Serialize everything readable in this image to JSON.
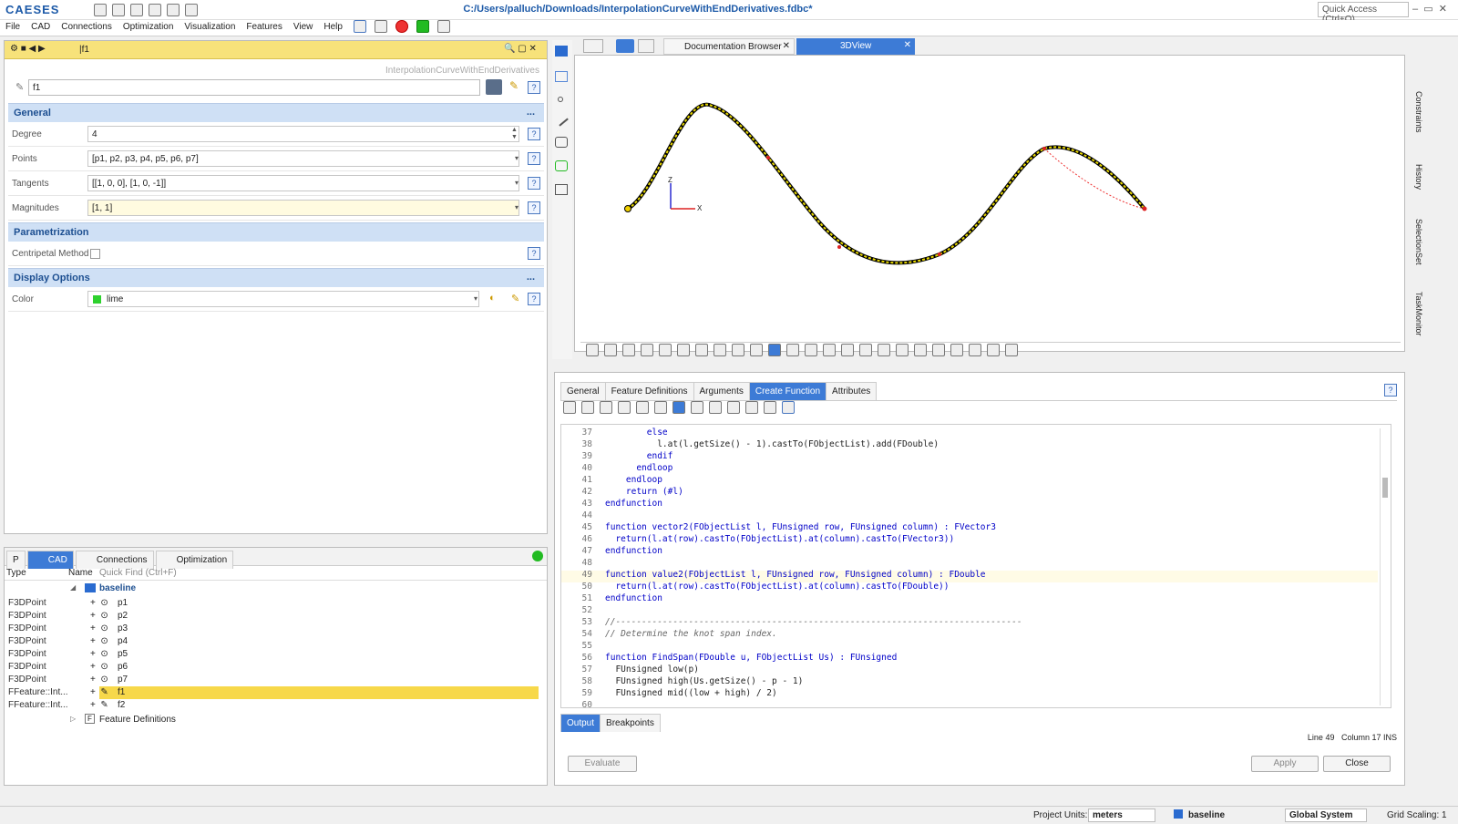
{
  "app": {
    "logo": "CAESES",
    "title": "C:/Users/palluch/Downloads/InterpolationCurveWithEndDerivatives.fdbc*",
    "quick_access": "Quick Access (Ctrl+Q)"
  },
  "menu": [
    "File",
    "CAD",
    "Connections",
    "Optimization",
    "Visualization",
    "Features",
    "View",
    "Help"
  ],
  "props": {
    "header_name": "|f1",
    "context": "InterpolationCurveWithEndDerivatives",
    "name_value": "f1",
    "general": "General",
    "parametrization": "Parametrization",
    "display": "Display Options",
    "more": "...",
    "rows": [
      {
        "label": "Degree",
        "value": "4"
      },
      {
        "label": "Points",
        "value": "[p1, p2, p3, p4, p5, p6, p7]"
      },
      {
        "label": "Tangents",
        "value": "[[1, 0, 0], [1, 0, -1]]"
      },
      {
        "label": "Magnitudes",
        "value": "[1, 1]"
      }
    ],
    "centripetal": "Centripetal Method",
    "color_label": "Color",
    "color_value": "lime"
  },
  "tree": {
    "tabs": [
      "P",
      "CAD",
      "Connections",
      "Optimization"
    ],
    "col_type": "Type",
    "col_name": "Name",
    "quick_find": "Quick Find (Ctrl+F)",
    "root": "baseline",
    "items": [
      {
        "type": "F3DPoint",
        "name": "p1"
      },
      {
        "type": "F3DPoint",
        "name": "p2"
      },
      {
        "type": "F3DPoint",
        "name": "p3"
      },
      {
        "type": "F3DPoint",
        "name": "p4"
      },
      {
        "type": "F3DPoint",
        "name": "p5"
      },
      {
        "type": "F3DPoint",
        "name": "p6"
      },
      {
        "type": "F3DPoint",
        "name": "p7"
      },
      {
        "type": "FFeature::Int...",
        "name": "f1"
      },
      {
        "type": "FFeature::Int...",
        "name": "f2"
      }
    ],
    "feature_defs": "Feature Definitions"
  },
  "views": {
    "tab1": "Documentation Browser",
    "tab2": "3DView",
    "axis_z": "Z",
    "axis_x": "X"
  },
  "editor": {
    "tabs": [
      "General",
      "Feature Definitions",
      "Arguments",
      "Create Function",
      "Attributes"
    ],
    "lines": [
      {
        "n": "37",
        "t": "        else"
      },
      {
        "n": "38",
        "t": "          l.at(l.getSize() - 1).castTo(FObjectList).add(FDouble)"
      },
      {
        "n": "39",
        "t": "        endif"
      },
      {
        "n": "40",
        "t": "      endloop"
      },
      {
        "n": "41",
        "t": "    endloop"
      },
      {
        "n": "42",
        "t": "    return (#l)"
      },
      {
        "n": "43",
        "t": "endfunction"
      },
      {
        "n": "44",
        "t": ""
      },
      {
        "n": "45",
        "t": "function vector2(FObjectList l, FUnsigned row, FUnsigned column) : FVector3"
      },
      {
        "n": "46",
        "t": "  return(l.at(row).castTo(FObjectList).at(column).castTo(FVector3))"
      },
      {
        "n": "47",
        "t": "endfunction"
      },
      {
        "n": "48",
        "t": ""
      },
      {
        "n": "49",
        "t": "function value2(FObjectList l, FUnsigned row, FUnsigned column) : FDouble"
      },
      {
        "n": "50",
        "t": "  return(l.at(row).castTo(FObjectList).at(column).castTo(FDouble))"
      },
      {
        "n": "51",
        "t": "endfunction"
      },
      {
        "n": "52",
        "t": ""
      },
      {
        "n": "53",
        "t": "//------------------------------------------------------------------------------"
      },
      {
        "n": "54",
        "t": "// Determine the knot span index."
      },
      {
        "n": "55",
        "t": ""
      },
      {
        "n": "56",
        "t": "function FindSpan(FDouble u, FObjectList Us) : FUnsigned"
      },
      {
        "n": "57",
        "t": "  FUnsigned low(p)"
      },
      {
        "n": "58",
        "t": "  FUnsigned high(Us.getSize() - p - 1)"
      },
      {
        "n": "59",
        "t": "  FUnsigned mid((low + high) / 2)"
      },
      {
        "n": "60",
        "t": ""
      }
    ],
    "out_tabs": [
      "Output",
      "Breakpoints"
    ],
    "line_status": "Line 49",
    "col_status": "Column 17 INS",
    "evaluate": "Evaluate",
    "apply": "Apply",
    "close": "Close"
  },
  "status": {
    "units_label": "Project Units:",
    "units": "meters",
    "baseline": "baseline",
    "system": "Global System",
    "grid": "Grid Scaling: 1"
  },
  "side": [
    "Constraints",
    "History",
    "SelectionSet",
    "TaskMonitor"
  ]
}
